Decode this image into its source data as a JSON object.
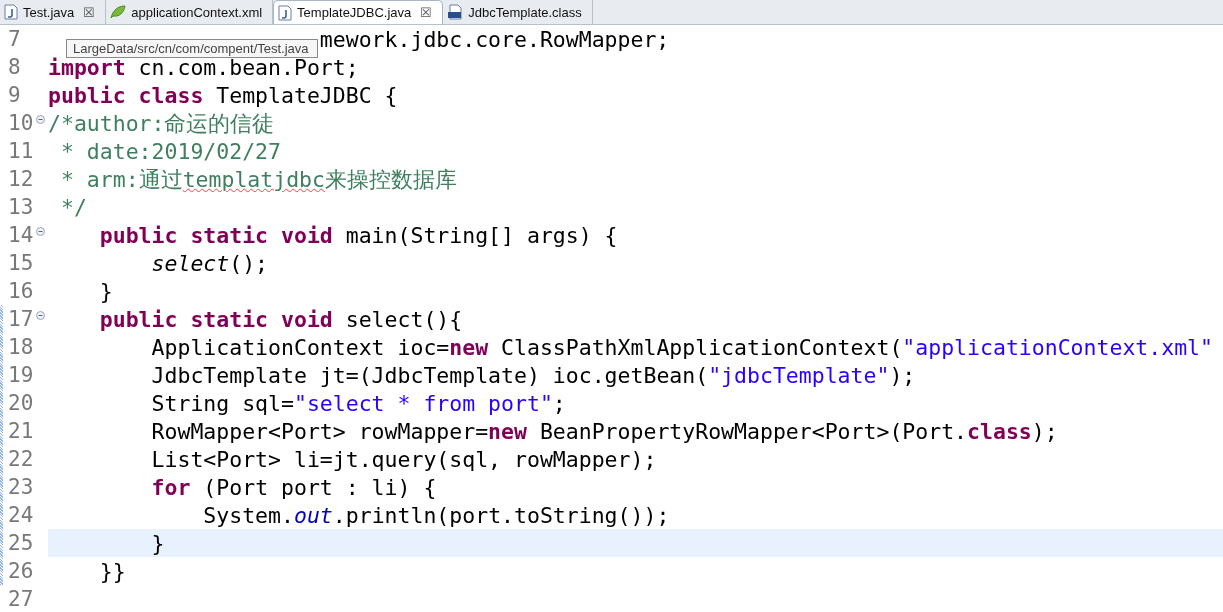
{
  "tabs": [
    {
      "label": "Test.java",
      "kind": "java",
      "closable": true,
      "selected": false
    },
    {
      "label": "applicationContext.xml",
      "kind": "xml",
      "closable": false,
      "selected": false
    },
    {
      "label": "TemplateJDBC.java",
      "kind": "java",
      "closable": true,
      "selected": true
    },
    {
      "label": "JdbcTemplate.class",
      "kind": "class",
      "closable": false,
      "selected": false
    }
  ],
  "close_glyph": "☒",
  "tooltip": "LargeData/src/cn/com/compent/Test.java",
  "lines": [
    {
      "number": "7",
      "foldable": false,
      "changed": false,
      "selected": false,
      "tokens": [
        {
          "kind": "plain",
          "text": "                     mework.jdbc.core.RowMapper;"
        }
      ]
    },
    {
      "number": "8",
      "foldable": false,
      "changed": false,
      "selected": false,
      "tokens": [
        {
          "kind": "keyword",
          "text": "import"
        },
        {
          "kind": "plain",
          "text": " cn.com.bean.Port;"
        }
      ]
    },
    {
      "number": "9",
      "foldable": false,
      "changed": false,
      "selected": false,
      "tokens": [
        {
          "kind": "keyword",
          "text": "public class"
        },
        {
          "kind": "plain",
          "text": " TemplateJDBC {"
        }
      ]
    },
    {
      "number": "10",
      "foldable": true,
      "changed": false,
      "selected": false,
      "tokens": [
        {
          "kind": "comment",
          "text": "/*author:命运的信徒"
        }
      ]
    },
    {
      "number": "11",
      "foldable": false,
      "changed": false,
      "selected": false,
      "tokens": [
        {
          "kind": "comment",
          "text": " * date:2019/02/27"
        }
      ]
    },
    {
      "number": "12",
      "foldable": false,
      "changed": false,
      "selected": false,
      "tokens": [
        {
          "kind": "comment",
          "text": " * arm:通过"
        },
        {
          "kind": "misspelled",
          "text": "templatjdbc"
        },
        {
          "kind": "comment",
          "text": "来操控数据库"
        }
      ]
    },
    {
      "number": "13",
      "foldable": false,
      "changed": false,
      "selected": false,
      "tokens": [
        {
          "kind": "comment",
          "text": " */"
        }
      ]
    },
    {
      "number": "14",
      "foldable": true,
      "changed": false,
      "selected": false,
      "tokens": [
        {
          "kind": "keyword",
          "text": "    public static void"
        },
        {
          "kind": "plain",
          "text": " main(String[] args) {"
        }
      ]
    },
    {
      "number": "15",
      "foldable": false,
      "changed": false,
      "selected": false,
      "tokens": [
        {
          "kind": "static",
          "text": "        select"
        },
        {
          "kind": "plain",
          "text": "();"
        }
      ]
    },
    {
      "number": "16",
      "foldable": false,
      "changed": false,
      "selected": false,
      "tokens": [
        {
          "kind": "plain",
          "text": "    }"
        }
      ]
    },
    {
      "number": "17",
      "foldable": true,
      "changed": true,
      "selected": false,
      "tokens": [
        {
          "kind": "keyword",
          "text": "    public static void"
        },
        {
          "kind": "plain",
          "text": " select(){"
        }
      ]
    },
    {
      "number": "18",
      "foldable": false,
      "changed": true,
      "selected": false,
      "tokens": [
        {
          "kind": "plain",
          "text": "        ApplicationContext ioc="
        },
        {
          "kind": "keyword",
          "text": "new"
        },
        {
          "kind": "plain",
          "text": " ClassPathXmlApplicationContext("
        },
        {
          "kind": "string",
          "text": "\"applicationContext.xml\""
        }
      ]
    },
    {
      "number": "19",
      "foldable": false,
      "changed": true,
      "selected": false,
      "tokens": [
        {
          "kind": "plain",
          "text": "        JdbcTemplate jt=(JdbcTemplate) ioc.getBean("
        },
        {
          "kind": "string",
          "text": "\"jdbcTemplate\""
        },
        {
          "kind": "plain",
          "text": ");"
        }
      ]
    },
    {
      "number": "20",
      "foldable": false,
      "changed": true,
      "selected": false,
      "tokens": [
        {
          "kind": "plain",
          "text": "        String sql="
        },
        {
          "kind": "string",
          "text": "\"select * from port\""
        },
        {
          "kind": "plain",
          "text": ";"
        }
      ]
    },
    {
      "number": "21",
      "foldable": false,
      "changed": true,
      "selected": false,
      "tokens": [
        {
          "kind": "plain",
          "text": "        RowMapper<Port> rowMapper="
        },
        {
          "kind": "keyword",
          "text": "new"
        },
        {
          "kind": "plain",
          "text": " BeanPropertyRowMapper<Port>(Port."
        },
        {
          "kind": "keyword",
          "text": "class"
        },
        {
          "kind": "plain",
          "text": ");"
        }
      ]
    },
    {
      "number": "22",
      "foldable": false,
      "changed": true,
      "selected": false,
      "tokens": [
        {
          "kind": "plain",
          "text": "        List<Port> li=jt.query(sql, rowMapper);"
        }
      ]
    },
    {
      "number": "23",
      "foldable": false,
      "changed": true,
      "selected": false,
      "tokens": [
        {
          "kind": "keyword",
          "text": "        for"
        },
        {
          "kind": "plain",
          "text": " (Port port : li) {"
        }
      ]
    },
    {
      "number": "24",
      "foldable": false,
      "changed": true,
      "selected": false,
      "tokens": [
        {
          "kind": "plain",
          "text": "            System."
        },
        {
          "kind": "field",
          "text": "out"
        },
        {
          "kind": "plain",
          "text": ".println(port.toString());"
        }
      ]
    },
    {
      "number": "25",
      "foldable": false,
      "changed": true,
      "selected": true,
      "tokens": [
        {
          "kind": "plain",
          "text": "        }"
        }
      ]
    },
    {
      "number": "26",
      "foldable": false,
      "changed": true,
      "selected": false,
      "tokens": [
        {
          "kind": "plain",
          "text": "    }}"
        }
      ]
    },
    {
      "number": "27",
      "foldable": false,
      "changed": false,
      "selected": false
    }
  ]
}
